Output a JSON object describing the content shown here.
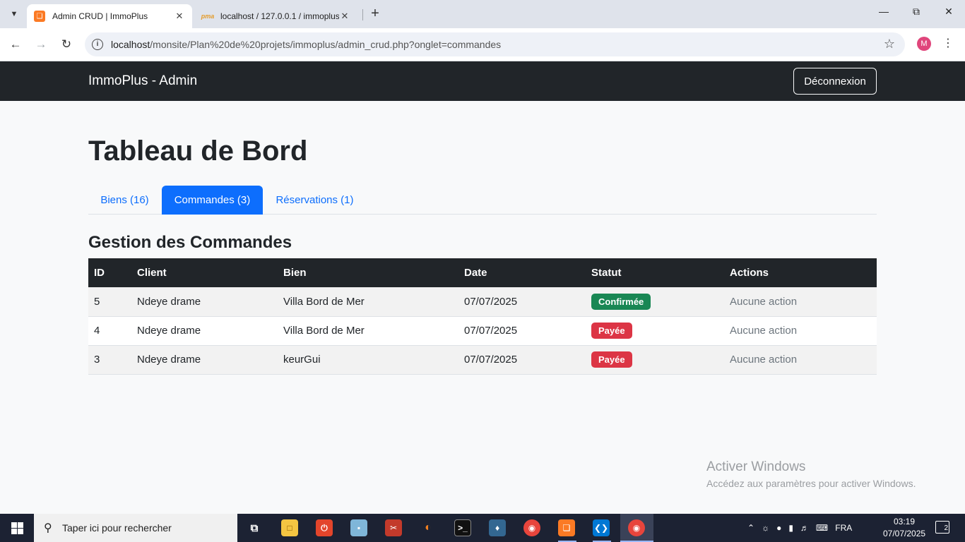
{
  "browser": {
    "tabs": [
      {
        "title": "Admin CRUD | ImmoPlus",
        "active": true
      },
      {
        "title": "localhost / 127.0.0.1 / immoplus",
        "active": false
      }
    ],
    "url_host": "localhost",
    "url_path": "/monsite/Plan%20de%20projets/immoplus/admin_crud.php?onglet=commandes",
    "profile_initial": "M"
  },
  "navbar": {
    "brand": "ImmoPlus - Admin",
    "logout_label": "Déconnexion"
  },
  "page": {
    "title": "Tableau de Bord",
    "tabs": [
      {
        "label": "Biens (16)",
        "active": false
      },
      {
        "label": "Commandes (3)",
        "active": true
      },
      {
        "label": "Réservations (1)",
        "active": false
      }
    ],
    "section_title": "Gestion des Commandes"
  },
  "table": {
    "headers": [
      "ID",
      "Client",
      "Bien",
      "Date",
      "Statut",
      "Actions"
    ],
    "rows": [
      {
        "id": "5",
        "client": "Ndeye drame",
        "bien": "Villa Bord de Mer",
        "date": "07/07/2025",
        "statut": "Confirmée",
        "actions": "Aucune action"
      },
      {
        "id": "4",
        "client": "Ndeye drame",
        "bien": "Villa Bord de Mer",
        "date": "07/07/2025",
        "statut": "Payée",
        "actions": "Aucune action"
      },
      {
        "id": "3",
        "client": "Ndeye drame",
        "bien": "keurGui",
        "date": "07/07/2025",
        "statut": "Payée",
        "actions": "Aucune action"
      }
    ]
  },
  "colors": {
    "primary": "#0d6efd",
    "dark": "#212529",
    "success": "#198754",
    "danger": "#dc3545"
  },
  "watermark": {
    "line1": "Activer Windows",
    "line2": "Accédez aux paramètres pour activer Windows."
  },
  "taskbar": {
    "search_placeholder": "Taper ici pour rechercher",
    "language": "FRA",
    "time": "03:19",
    "date": "07/07/2025",
    "notifications": "2"
  }
}
